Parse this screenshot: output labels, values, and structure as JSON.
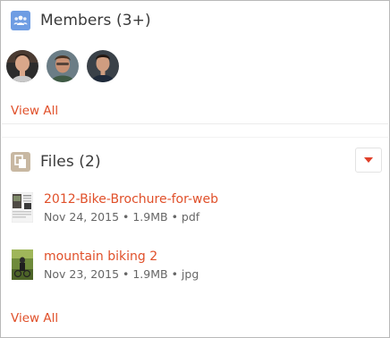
{
  "members": {
    "title": "Members (3+)",
    "icon": "group-icon",
    "view_all": "View All",
    "avatars": [
      {
        "name": "member-avatar-1"
      },
      {
        "name": "member-avatar-2"
      },
      {
        "name": "member-avatar-3"
      }
    ]
  },
  "files": {
    "title": "Files (2)",
    "icon": "files-icon",
    "dropdown_icon": "chevron-down-icon",
    "view_all": "View All",
    "items": [
      {
        "name": "2012-Bike-Brochure-for-web",
        "meta": "Nov 24, 2015 • 1.9MB • pdf"
      },
      {
        "name": "mountain biking 2",
        "meta": "Nov 23, 2015 • 1.9MB • jpg"
      }
    ]
  },
  "colors": {
    "accent": "#e0502a",
    "members_icon_bg": "#6e9de3",
    "files_icon_bg": "#c8b8a2"
  }
}
